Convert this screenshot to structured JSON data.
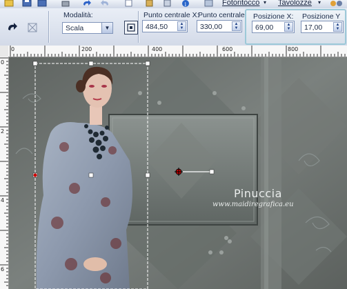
{
  "menu": {
    "fotoritocco": "Fotoritocco",
    "tavolozze": "Tavolozze"
  },
  "options": {
    "mode_label": "Modalità:",
    "mode_value": "Scala",
    "center_x_label": "Punto centrale X:",
    "center_x_value": "484,50",
    "center_y_label": "Punto centrale Y",
    "center_y_value": "330,00",
    "pos_x_label": "Posizione X:",
    "pos_x_value": "69,00",
    "pos_y_label": "Posizione Y",
    "pos_y_value": "17,00"
  },
  "ruler": {
    "h_labels": [
      "0",
      "200",
      "400",
      "600",
      "800"
    ],
    "v_labels": [
      "0",
      "2",
      "4",
      "6"
    ]
  },
  "canvas": {
    "title": "Pinuccia",
    "url": "www.maidiregrafica.eu"
  },
  "icons": [
    "save-icon",
    "undo-icon",
    "redo-icon",
    "info-icon",
    "deform-tool-icon",
    "reset-icon",
    "center-icon"
  ],
  "colors": {
    "canvas_bg": "#6f7471",
    "selection_border": "#ffffff",
    "pick_handle": "#cc0000"
  }
}
